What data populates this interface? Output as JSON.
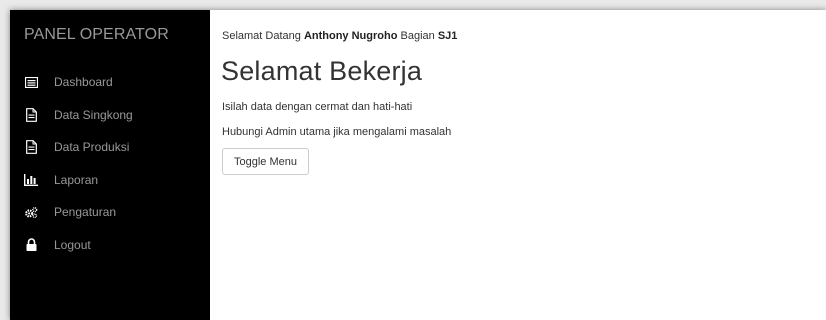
{
  "sidebar": {
    "brand": "PANEL OPERATOR",
    "items": [
      {
        "label": "Dashboard",
        "icon": "list-alt-icon"
      },
      {
        "label": "Data Singkong",
        "icon": "file-icon"
      },
      {
        "label": "Data Produksi",
        "icon": "file-icon"
      },
      {
        "label": "Laporan",
        "icon": "bar-chart-icon"
      },
      {
        "label": "Pengaturan",
        "icon": "cogs-icon"
      },
      {
        "label": "Logout",
        "icon": "lock-icon"
      }
    ]
  },
  "main": {
    "welcome_prefix": "Selamat Datang",
    "user_name": "Anthony Nugroho",
    "welcome_mid": "Bagian",
    "department": "SJ1",
    "headline": "Selamat Bekerja",
    "paragraph1": "Isilah data dengan cermat dan hati-hati",
    "paragraph2": "Hubungi Admin utama jika mengalami masalah",
    "toggle_label": "Toggle Menu"
  },
  "colors": {
    "sidebar_bg": "#000000",
    "sidebar_text": "#999999",
    "main_text": "#333333"
  }
}
